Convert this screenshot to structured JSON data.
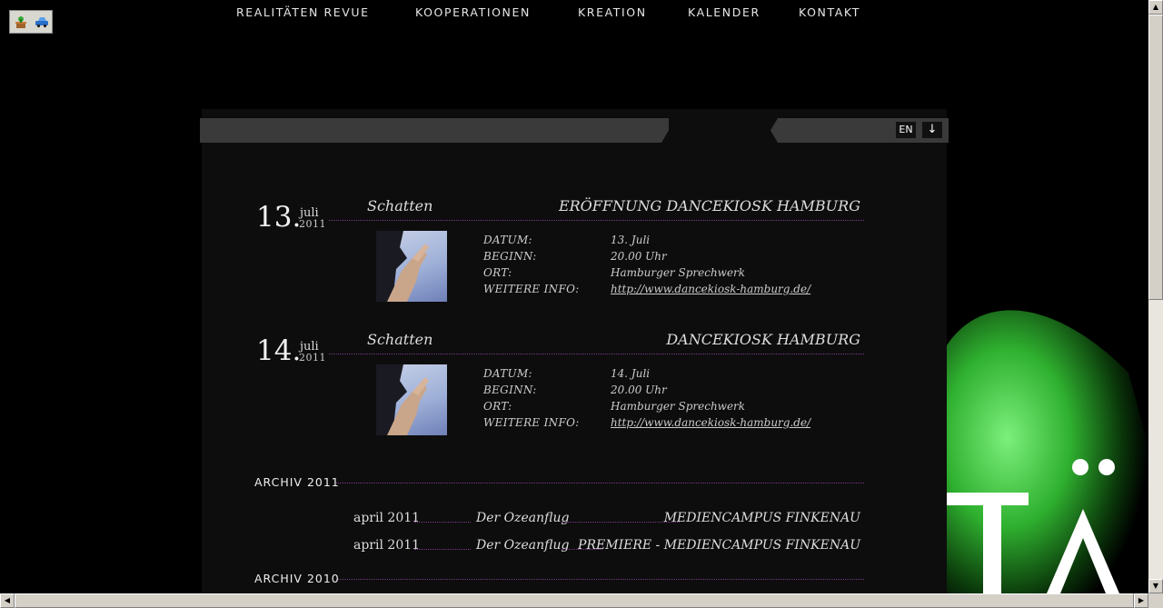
{
  "nav": {
    "items": [
      "REALITÄTEN REVUE",
      "KOOPERATIONEN",
      "KREATION",
      "KALENDER",
      "KONTAKT"
    ],
    "active": "KALENDER",
    "lang_label": "EN",
    "down_icon": "↓"
  },
  "events": [
    {
      "day": "13.",
      "month": "juli",
      "year": "2011",
      "title": "Schatten",
      "venue": "ERÖFFNUNG DANCEKIOSK HAMBURG",
      "labels": [
        "DATUM:",
        "BEGINN:",
        "ORT:",
        "WEITERE INFO:"
      ],
      "values": [
        "13. Juli",
        "20.00 Uhr",
        "Hamburger Sprechwerk",
        "http://www.dancekiosk-hamburg.de/"
      ]
    },
    {
      "day": "14.",
      "month": "juli",
      "year": "2011",
      "title": "Schatten",
      "venue": "DANCEKIOSK HAMBURG",
      "labels": [
        "DATUM:",
        "BEGINN:",
        "ORT:",
        "WEITERE INFO:"
      ],
      "values": [
        "14. Juli",
        "20.00 Uhr",
        "Hamburger Sprechwerk",
        "http://www.dancekiosk-hamburg.de/"
      ]
    }
  ],
  "archives": [
    {
      "heading": "ARCHIV 2011",
      "entries": [
        {
          "date": "april 2011",
          "title": "Der Ozeanflug",
          "venue": "MEDIENCAMPUS FINKENAU"
        },
        {
          "date": "april 2011",
          "title": "Der Ozeanflug",
          "venue": "PREMIERE - MEDIENCAMPUS FINKENAU"
        }
      ]
    },
    {
      "heading": "ARCHIV 2010",
      "entries": []
    }
  ],
  "colors": {
    "background": "#000000",
    "panel": "#0d0d0d",
    "nav_bar": "#3a3a3a",
    "dotted_line": "#7a3a88",
    "art_green": "#3cc83c"
  },
  "icons": {
    "toolbar": [
      "plant-pot-icon",
      "car-icon"
    ],
    "scroll": [
      "arrow-up-icon",
      "arrow-down-icon",
      "arrow-left-icon",
      "arrow-right-icon"
    ]
  }
}
